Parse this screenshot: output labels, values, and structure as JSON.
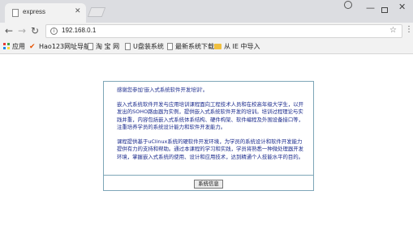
{
  "browser": {
    "tab_title": "express",
    "tab_close": "✕",
    "url": "192.168.0.1",
    "win_minimize": "—",
    "win_close": "✕"
  },
  "bookmarks": [
    {
      "label": "应用",
      "icon": "apps-grid-icon"
    },
    {
      "label": "Hao123网址导航",
      "icon": "hao123-icon"
    },
    {
      "label": "淘 宝 网",
      "icon": "page-icon"
    },
    {
      "label": "U盘装系统",
      "icon": "page-icon"
    },
    {
      "label": "最新系统下载",
      "icon": "page-icon"
    },
    {
      "label": "从 IE 中导入",
      "icon": "folder-icon"
    }
  ],
  "page": {
    "para1": "感谢您参加'嵌入式系统软件开发培训'。",
    "para2": "嵌入式系统软件开发与应用培训课程面向工程技术人员和在校高年级大学生，以开发出的SOHO路由器为实例，提供嵌入式系统软件开发的培训。培训过程理论与实践并重，内容包括嵌入式系统体系结构、硬件构架、软件编程及外围设备接口等，注重培养学员的系统设计能力和软件开发能力。",
    "para3": "课程提供基于uClinux系统的硬软件开发环境，为学员的系统设计和软件开发能力提供有力的支持和帮助。通过本课程的学习和实践，学员将熟悉一种微处理器开发环境，掌握嵌入式系统的使用、设计和应用技术，达到精通个人技能水平的目的。",
    "button_label": "系统信息"
  }
}
